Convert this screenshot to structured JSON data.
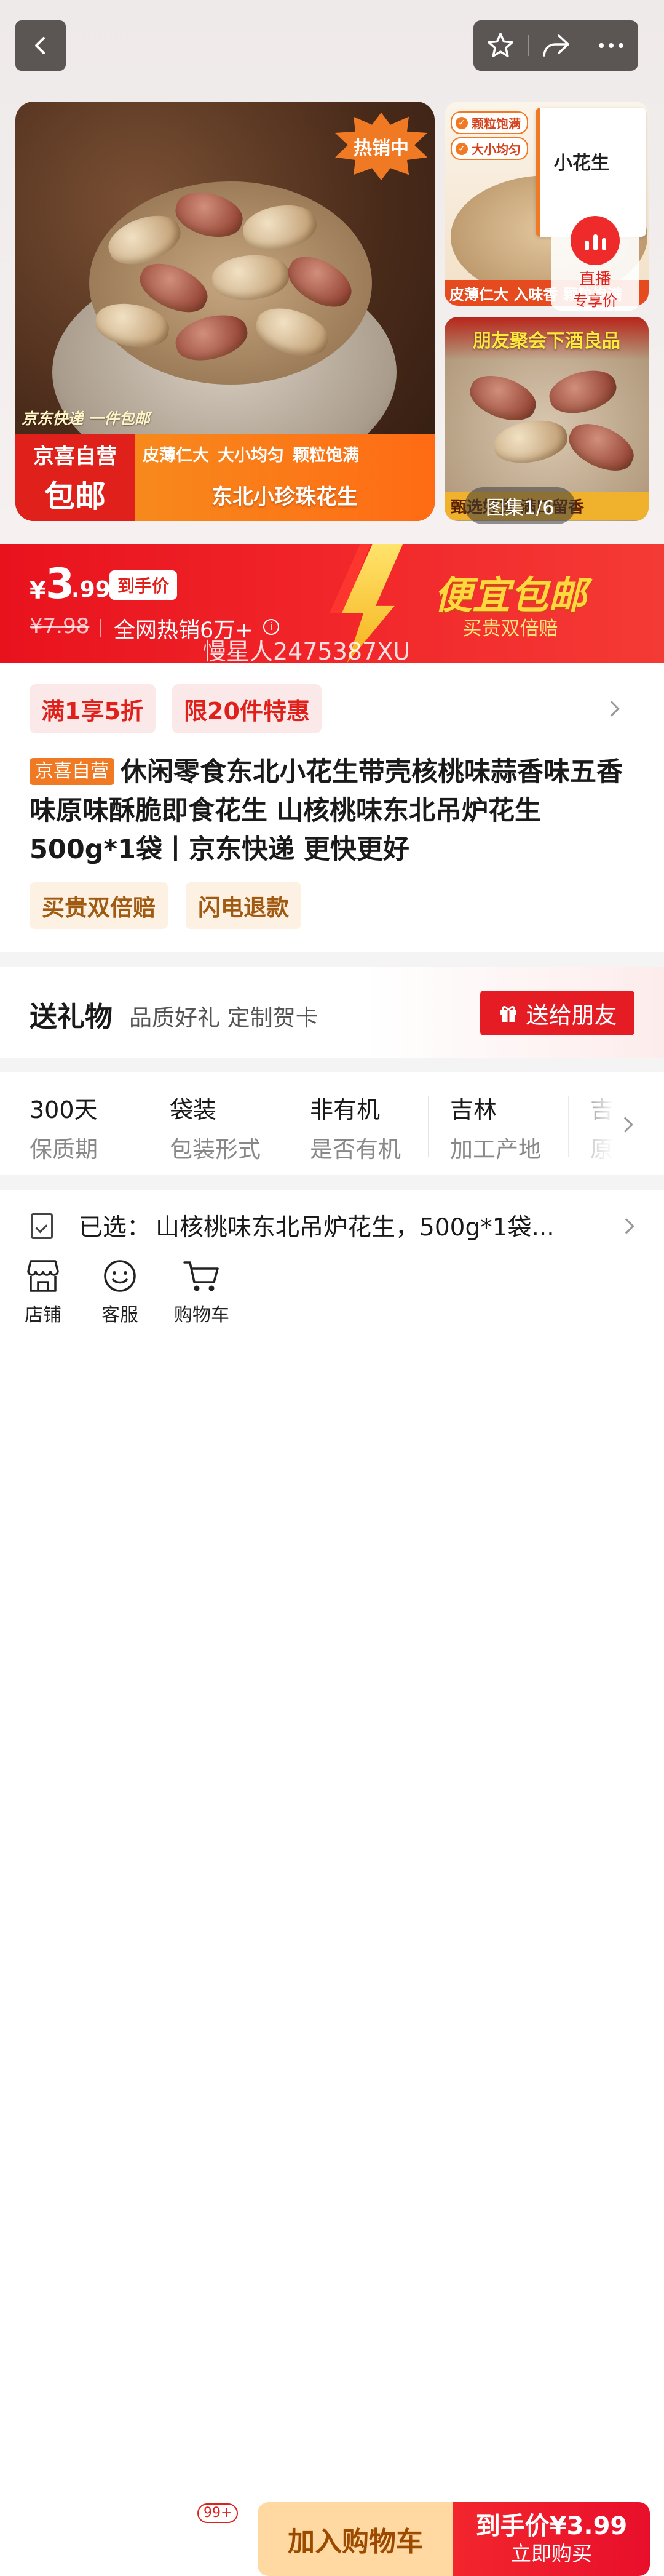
{
  "gallery": {
    "hot_badge": "热销中",
    "express_tag": "京东快递  一件包邮",
    "self_run_line1": "京喜自营",
    "self_run_line2": "包邮",
    "features": [
      "皮薄仁大",
      "大小均匀",
      "颗粒饱满"
    ],
    "product_banner": "东北小珍珠花生",
    "thumb1_tags": [
      "颗粒饱满",
      "大小均匀"
    ],
    "thumb1_pack_name": "小花生",
    "thumb1_caption": "皮薄仁大 入味香 颗粒饱满",
    "thumb2_title": "朋友聚会下酒良品",
    "thumb2_caption": "甄选好货 满口留香",
    "live_label": "直播",
    "live_sub": "专享价",
    "page_counter": "图集1/6"
  },
  "price": {
    "currency": "¥",
    "integer": "3",
    "decimal": ".99",
    "tag": "到手价",
    "original": "¥7.98",
    "sales": "全网热销6万+",
    "info_icon": "i",
    "promo_title": "便宜包邮",
    "promo_sub": "买贵双倍赔"
  },
  "watermark": "慢星人2475387XU",
  "promo_chips": [
    "满1享5折",
    "限20件特惠"
  ],
  "title": {
    "badge": "京喜自营",
    "text": "休闲零食东北小花生带壳核桃味蒜香味五香味原味酥脆即食花生 山核桃味东北吊炉花生 500g*1袋丨京东快递 更快更好"
  },
  "service_chips": [
    "买贵双倍赔",
    "闪电退款"
  ],
  "gift": {
    "title": "送礼物",
    "sub": "品质好礼 定制贺卡",
    "button": "送给朋友"
  },
  "specs": [
    {
      "value": "300天",
      "key": "保质期"
    },
    {
      "value": "袋装",
      "key": "包装形式"
    },
    {
      "value": "非有机",
      "key": "是否有机"
    },
    {
      "value": "吉林",
      "key": "加工产地"
    },
    {
      "value": "吉",
      "key": "原"
    }
  ],
  "selected": {
    "label": "已选：",
    "value": "山核桃味东北吊炉花生，500g*1袋..."
  },
  "bottom_bar": {
    "store": "店铺",
    "service": "客服",
    "cart": "购物车",
    "cart_badge": "99+",
    "add_to_cart": "加入购物车",
    "buy_top": "到手价¥3.99",
    "buy_bottom": "立即购买"
  },
  "colors": {
    "brand_red": "#e0201b",
    "orange": "#f07a24",
    "cart_button": "#ffd8a2"
  }
}
